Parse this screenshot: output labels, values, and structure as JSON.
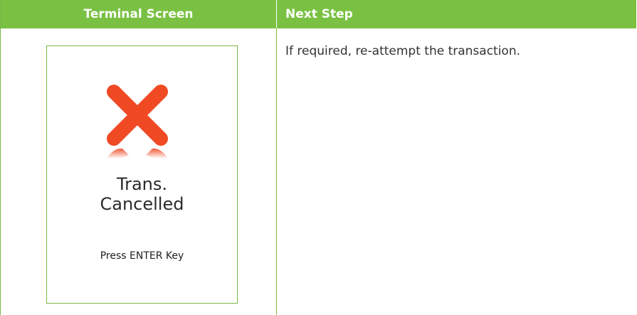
{
  "table": {
    "headers": {
      "terminal_screen": "Terminal Screen",
      "next_step": "Next Step"
    }
  },
  "terminal": {
    "title_line1": "Trans.",
    "title_line2": "Cancelled",
    "prompt": "Press ENTER Key",
    "icon": "cross-icon"
  },
  "next_step": {
    "text": "If required, re-attempt the transaction."
  },
  "colors": {
    "header_green": "#7ac143",
    "border_green": "#7ab648",
    "cross_red": "#f04a24"
  }
}
